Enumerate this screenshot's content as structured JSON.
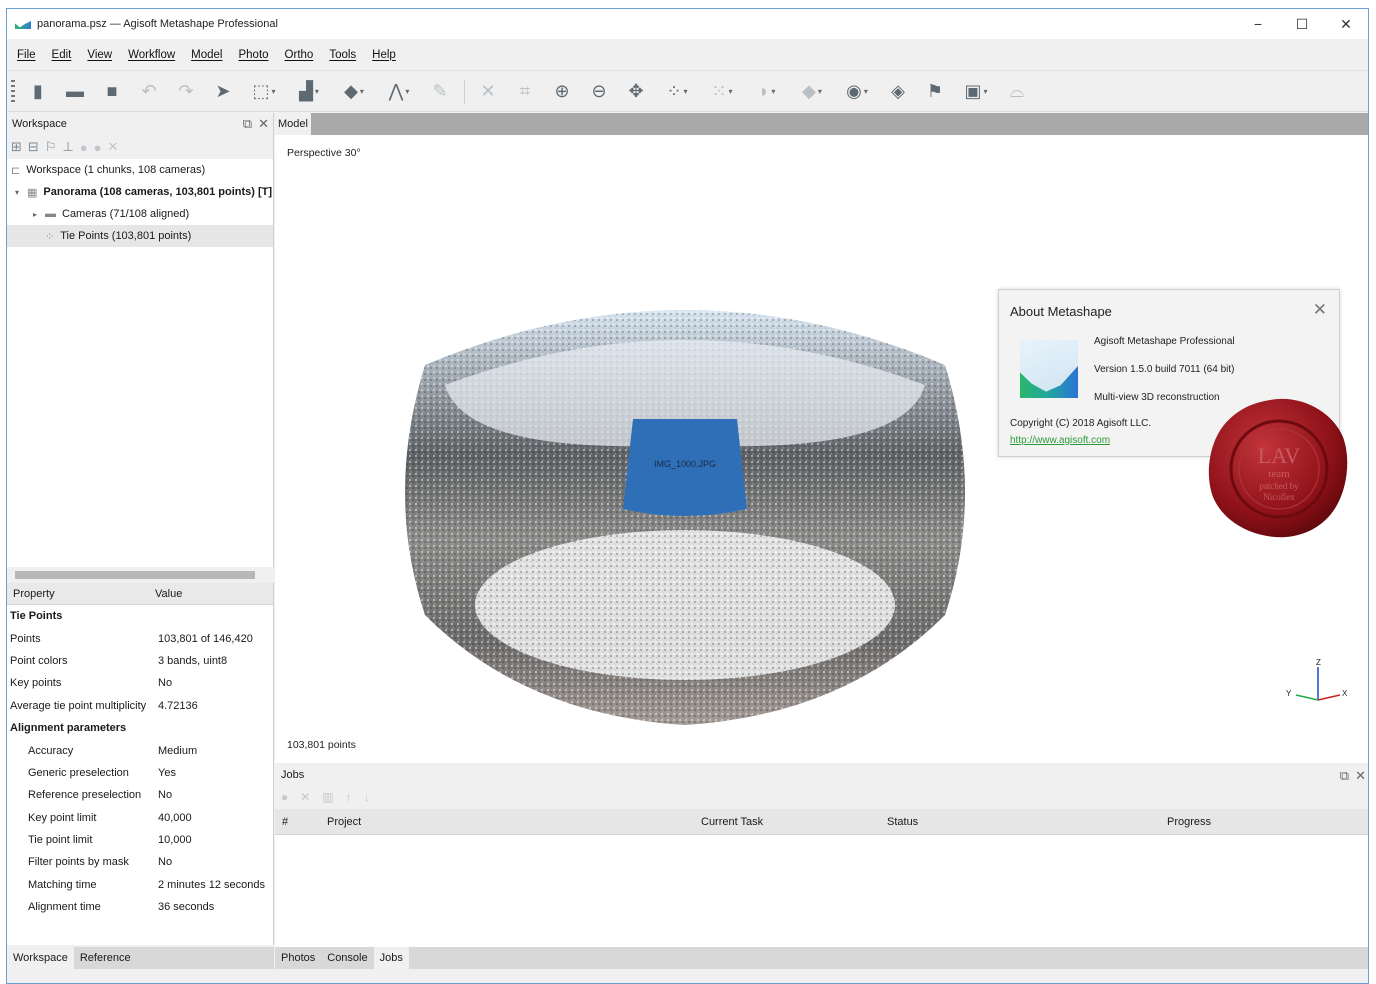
{
  "window": {
    "title": "panorama.psz — Agisoft Metashape Professional",
    "minimize": "−",
    "maximize": "☐",
    "close": "✕"
  },
  "menu": [
    "File",
    "Edit",
    "View",
    "Workflow",
    "Model",
    "Photo",
    "Ortho",
    "Tools",
    "Help"
  ],
  "workspace": {
    "title": "Workspace",
    "tree": {
      "root": "Workspace (1 chunks, 108 cameras)",
      "chunk": "Panorama (108 cameras, 103,801 points) [T]",
      "cameras": "Cameras (71/108 aligned)",
      "tie_points": "Tie Points (103,801 points)"
    }
  },
  "properties": {
    "col_property": "Property",
    "col_value": "Value",
    "rows": [
      {
        "label": "Tie Points",
        "value": "",
        "group": true
      },
      {
        "label": "Points",
        "value": "103,801 of 146,420"
      },
      {
        "label": "Point colors",
        "value": "3 bands, uint8"
      },
      {
        "label": "Key points",
        "value": "No"
      },
      {
        "label": "Average tie point multiplicity",
        "value": "4.72136"
      },
      {
        "label": "Alignment parameters",
        "value": "",
        "group": true
      },
      {
        "label": "Accuracy",
        "value": "Medium",
        "indent": true
      },
      {
        "label": "Generic preselection",
        "value": "Yes",
        "indent": true
      },
      {
        "label": "Reference preselection",
        "value": "No",
        "indent": true
      },
      {
        "label": "Key point limit",
        "value": "40,000",
        "indent": true
      },
      {
        "label": "Tie point limit",
        "value": "10,000",
        "indent": true
      },
      {
        "label": "Filter points by mask",
        "value": "No",
        "indent": true
      },
      {
        "label": "Matching time",
        "value": "2 minutes 12 seconds",
        "indent": true
      },
      {
        "label": "Alignment time",
        "value": "36 seconds",
        "indent": true
      }
    ]
  },
  "left_tabs": [
    "Workspace",
    "Reference"
  ],
  "model": {
    "tab": "Model",
    "perspective": "Perspective 30°",
    "points": "103,801 points",
    "camera_label": "IMG_1000.JPG",
    "axes": {
      "z": "Z",
      "y": "Y",
      "x": "X"
    }
  },
  "about": {
    "title": "About Metashape",
    "product": "Agisoft Metashape Professional",
    "version": "Version 1.5.0 build 7011 (64 bit)",
    "tagline": "Multi-view 3D reconstruction",
    "copyright": "Copyright (C) 2018 Agisoft LLC.",
    "link": "http://www.agisoft.com"
  },
  "seal": {
    "text1": "LAV",
    "text2": "team",
    "text3": "patched by",
    "text4": "Nicoflex"
  },
  "jobs": {
    "title": "Jobs",
    "columns": [
      "#",
      "Project",
      "Current Task",
      "Status",
      "Progress"
    ]
  },
  "right_tabs": [
    "Photos",
    "Console",
    "Jobs"
  ],
  "colors": {
    "accent": "#2d9a3a",
    "tab_bar": "#a9a9a9",
    "seal": "#8e1118"
  }
}
